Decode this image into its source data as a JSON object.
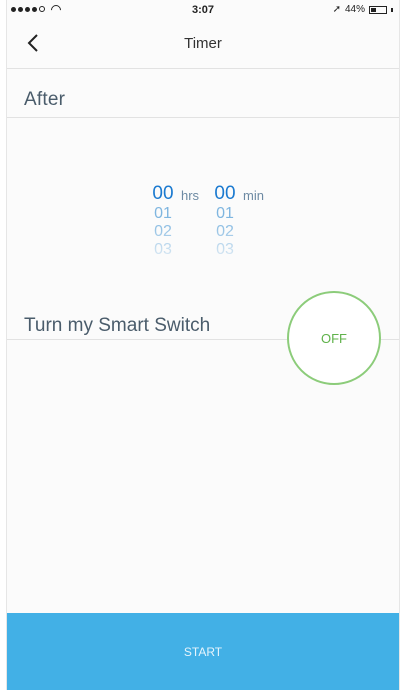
{
  "status_bar": {
    "time": "3:07",
    "battery": "44%",
    "battery_level": 0.44
  },
  "nav": {
    "title": "Timer",
    "back_icon": "chevron-left-icon"
  },
  "after": {
    "label": "After"
  },
  "picker": {
    "hours": [
      "00",
      "01",
      "02",
      "03"
    ],
    "minutes": [
      "00",
      "01",
      "02",
      "03"
    ],
    "hours_unit": "hrs",
    "minutes_unit": "min"
  },
  "switch": {
    "label": "Turn my Smart Switch",
    "state": "OFF",
    "accent": "#8ccc7a"
  },
  "footer": {
    "start_label": "START",
    "color": "#42b0e6"
  }
}
